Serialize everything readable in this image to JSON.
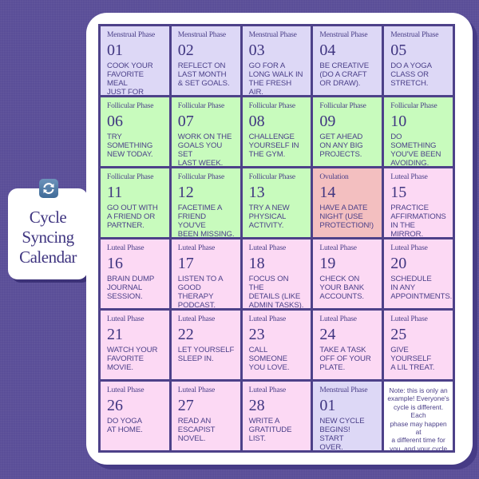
{
  "title": {
    "text": "Cycle\nSyncing\nCalendar",
    "icon": "sync-arrows-icon"
  },
  "colors": {
    "background": "#5a4e98",
    "menstrual": "#ddd8f6",
    "follicular": "#c8fbbd",
    "ovulation": "#f3bfc0",
    "luteal": "#fcd9f4",
    "text": "#4a3f88"
  },
  "days": [
    {
      "phase_type": "menstrual",
      "phase": "Menstrual Phase",
      "day": "01",
      "task": "Cook your\nfavorite meal\njust for you,"
    },
    {
      "phase_type": "menstrual",
      "phase": "Menstrual Phase",
      "day": "02",
      "task": "Reflect on\nlast month\n& set goals."
    },
    {
      "phase_type": "menstrual",
      "phase": "Menstrual Phase",
      "day": "03",
      "task": "Go for a\nlong walk in\nthe fresh air."
    },
    {
      "phase_type": "menstrual",
      "phase": "Menstrual Phase",
      "day": "04",
      "task": "Be creative\n(do a craft\nor draw)."
    },
    {
      "phase_type": "menstrual",
      "phase": "Menstrual Phase",
      "day": "05",
      "task": "Do a yoga\nclass or\nstretch."
    },
    {
      "phase_type": "follicular",
      "phase": "Follicular Phase",
      "day": "06",
      "task": "Try\nsomething\nnew today."
    },
    {
      "phase_type": "follicular",
      "phase": "Follicular Phase",
      "day": "07",
      "task": "Work on the\ngoals you set\nlast week."
    },
    {
      "phase_type": "follicular",
      "phase": "Follicular Phase",
      "day": "08",
      "task": "Challenge\nyourself in\nthe gym."
    },
    {
      "phase_type": "follicular",
      "phase": "Follicular Phase",
      "day": "09",
      "task": "Get ahead\non any big\nprojects."
    },
    {
      "phase_type": "follicular",
      "phase": "Follicular Phase",
      "day": "10",
      "task": "Do something\nyou've been\navoiding."
    },
    {
      "phase_type": "follicular",
      "phase": "Follicular Phase",
      "day": "11",
      "task": "Go out with\na friend or\npartner."
    },
    {
      "phase_type": "follicular",
      "phase": "Follicular Phase",
      "day": "12",
      "task": "Facetime a\nfriend you've\nbeen missing."
    },
    {
      "phase_type": "follicular",
      "phase": "Follicular Phase",
      "day": "13",
      "task": "Try a new\nphysical\nactivity."
    },
    {
      "phase_type": "ovulation",
      "phase": "Ovulation",
      "day": "14",
      "task": "Have a date\nnight (use\nprotection!)"
    },
    {
      "phase_type": "luteal",
      "phase": "Luteal Phase",
      "day": "15",
      "task": "Practice\naffirmations\nin the mirror."
    },
    {
      "phase_type": "luteal",
      "phase": "Luteal Phase",
      "day": "16",
      "task": "Brain dump\njournal\nsession."
    },
    {
      "phase_type": "luteal",
      "phase": "Luteal Phase",
      "day": "17",
      "task": "Listen to a\ngood therapy\npodcast."
    },
    {
      "phase_type": "luteal",
      "phase": "Luteal Phase",
      "day": "18",
      "task": "Focus on the\ndetails (like\nadmin tasks)."
    },
    {
      "phase_type": "luteal",
      "phase": "Luteal Phase",
      "day": "19",
      "task": "Check on\nyour bank\naccounts."
    },
    {
      "phase_type": "luteal",
      "phase": "Luteal Phase",
      "day": "20",
      "task": "Schedule\nin any\nappointments."
    },
    {
      "phase_type": "luteal",
      "phase": "Luteal Phase",
      "day": "21",
      "task": "Watch your\nfavorite\nmovie."
    },
    {
      "phase_type": "luteal",
      "phase": "Luteal Phase",
      "day": "22",
      "task": "Let yourself\nsleep in."
    },
    {
      "phase_type": "luteal",
      "phase": "Luteal Phase",
      "day": "23",
      "task": "Call someone\nyou love."
    },
    {
      "phase_type": "luteal",
      "phase": "Luteal Phase",
      "day": "24",
      "task": "Take a task\noff of your\nplate."
    },
    {
      "phase_type": "luteal",
      "phase": "Luteal Phase",
      "day": "25",
      "task": "Give yourself\na lil treat."
    },
    {
      "phase_type": "luteal",
      "phase": "Luteal Phase",
      "day": "26",
      "task": "Do yoga\nat home."
    },
    {
      "phase_type": "luteal",
      "phase": "Luteal Phase",
      "day": "27",
      "task": "Read an\nescapist\nnovel."
    },
    {
      "phase_type": "luteal",
      "phase": "Luteal Phase",
      "day": "28",
      "task": "Write a\ngratitude\nlist."
    },
    {
      "phase_type": "menstrual",
      "phase": "Menstrual Phase",
      "day": "01",
      "task": "New cycle\nbegins! Start\nover."
    }
  ],
  "note": "Note: this is only an\nexample! Everyone's\ncycle is different. Each\nphase may happen at\na different time for\nyou, and your cycle\nmay be longer or\nshorter."
}
